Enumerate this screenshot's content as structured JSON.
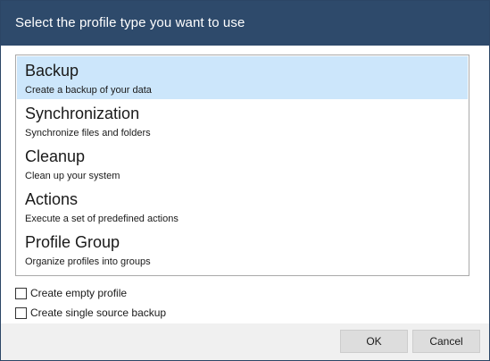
{
  "dialog": {
    "title": "Select the profile type you want to use"
  },
  "profile_types": [
    {
      "title": "Backup",
      "description": "Create a backup of your data",
      "selected": true
    },
    {
      "title": "Synchronization",
      "description": "Synchronize files and folders",
      "selected": false
    },
    {
      "title": "Cleanup",
      "description": "Clean up your system",
      "selected": false
    },
    {
      "title": "Actions",
      "description": "Execute a set of predefined actions",
      "selected": false
    },
    {
      "title": "Profile Group",
      "description": "Organize profiles into groups",
      "selected": false
    }
  ],
  "options": {
    "empty_profile_label": "Create empty profile",
    "empty_profile_checked": false,
    "single_source_label": "Create single source backup",
    "single_source_checked": false
  },
  "buttons": {
    "ok_label": "OK",
    "cancel_label": "Cancel"
  },
  "colors": {
    "header_bg": "#2e4a6b",
    "selection_bg": "#cce6fb"
  }
}
